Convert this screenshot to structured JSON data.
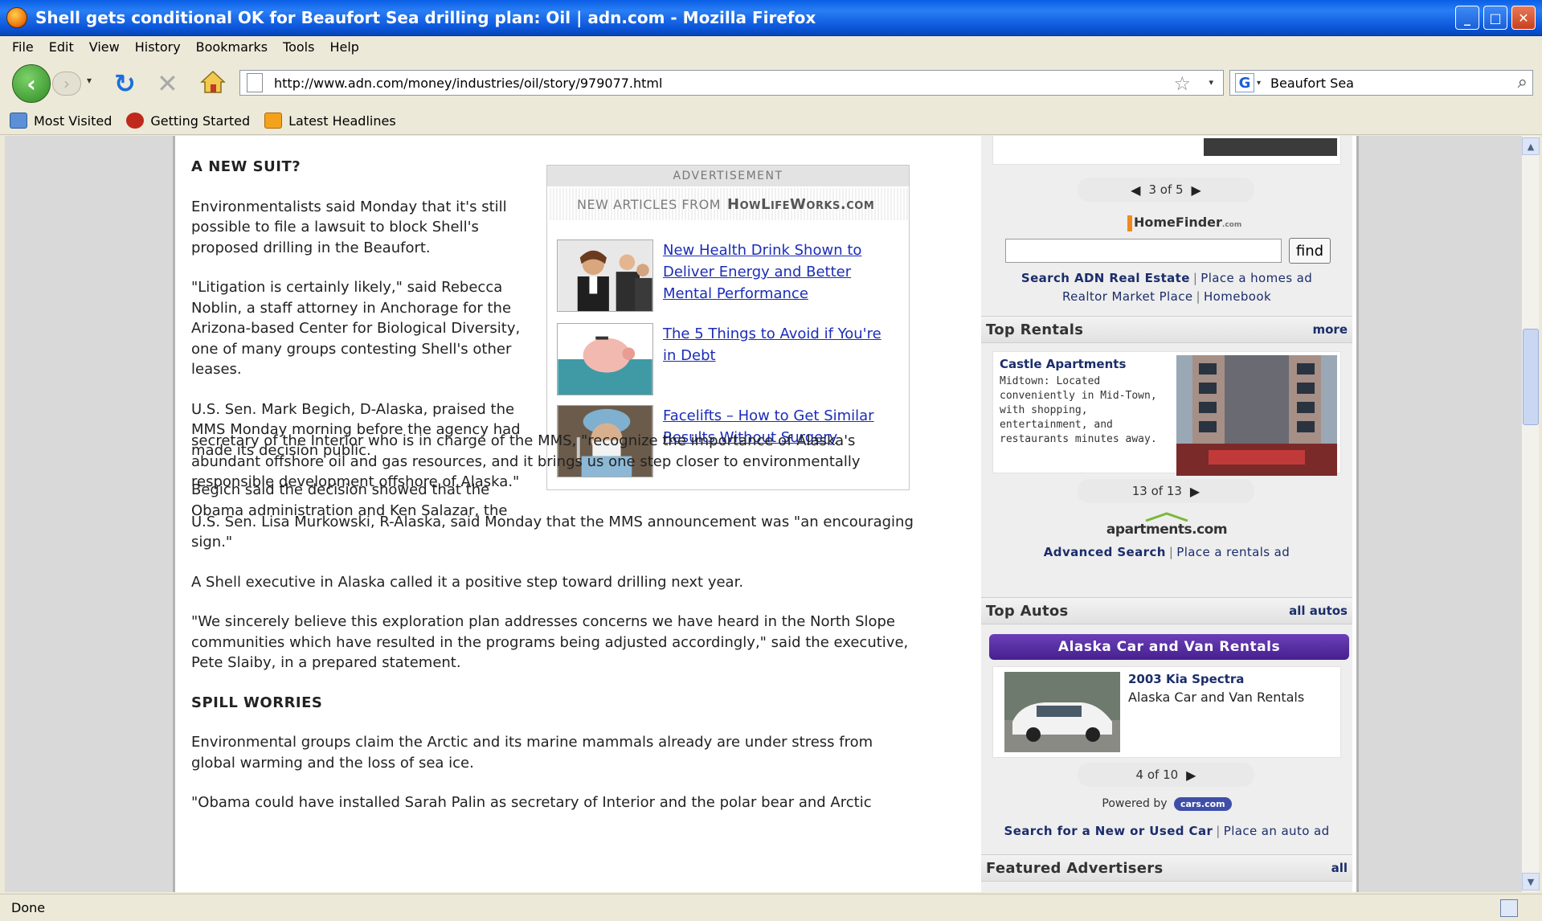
{
  "window": {
    "title": "Shell gets conditional OK for Beaufort Sea drilling plan: Oil | adn.com - Mozilla Firefox",
    "minimize": "_",
    "maximize": "□",
    "close": "✕"
  },
  "menu": [
    "File",
    "Edit",
    "View",
    "History",
    "Bookmarks",
    "Tools",
    "Help"
  ],
  "nav": {
    "back": "‹",
    "forward": "›",
    "dropdown": "▾",
    "reload": "↻",
    "stop": "✕",
    "url": "http://www.adn.com/money/industries/oil/story/979077.html",
    "star": "☆",
    "url_dropdown": "▾",
    "search_engine": "G",
    "search_engine_dropdown": "▾",
    "search_query": "Beaufort Sea",
    "search_icon": "⌕"
  },
  "bookmarks": [
    "Most Visited",
    "Getting Started",
    "Latest Headlines"
  ],
  "article": {
    "heading1": "A NEW SUIT?",
    "p1": "Environmentalists said Monday that it's still possible to file a lawsuit to block Shell's proposed drilling in the Beaufort.",
    "p2": "\"Litigation is certainly likely,\" said Rebecca Noblin, a staff attorney in Anchorage for the Arizona-based Center for Biological Diversity, one of many groups contesting Shell's other leases.",
    "p3": "U.S. Sen. Mark Begich, D-Alaska, praised the MMS Monday morning before the agency had made its decision public.",
    "p4a": "Begich said the decision showed that the Obama administration and Ken Salazar, the",
    "p4b": "secretary of the Interior who is in charge of the MMS, \"recognize the importance of Alaska's abundant offshore oil and gas resources, and it brings us one step closer to environmentally responsible development offshore of Alaska.\"",
    "p5": "U.S. Sen. Lisa Murkowski, R-Alaska, said Monday that the MMS announcement was \"an encouraging sign.\"",
    "p6": "A Shell executive in Alaska called it a positive step toward drilling next year.",
    "p7": "\"We sincerely believe this exploration plan addresses concerns we have heard in the North Slope communities which have resulted in the programs being adjusted accordingly,\" said the executive, Pete Slaiby, in a prepared statement.",
    "heading2": "SPILL WORRIES",
    "p8": "Environmental groups claim the Arctic and its marine mammals already are under stress from global warming and the loss of sea ice.",
    "p9": "\"Obama could have installed Sarah Palin as secretary of Interior and the polar bear and Arctic"
  },
  "ad": {
    "label": "ADVERTISEMENT",
    "header_prefix": "NEW ARTICLES FROM",
    "header_brand": "HowLifeWorks.com",
    "items": [
      {
        "text": "New Health Drink Shown to Deliver Energy and Better Mental Performance"
      },
      {
        "text": "The 5 Things to Avoid if You're in Debt"
      },
      {
        "text": "Facelifts – How to Get Similar Results Without Surgery"
      }
    ]
  },
  "right": {
    "homes_pager": "3 of 5",
    "homefinder_logo": "HomeFinder",
    "homefinder_logo_sub": ".com",
    "find_button": "find",
    "search_re": "Search ADN Real Estate",
    "place_homes": "Place a homes ad",
    "realtor": "Realtor Market Place",
    "homebook": "Homebook",
    "rentals_title": "Top Rentals",
    "rentals_more": "more",
    "rental_name": "Castle Apartments",
    "rental_desc": "Midtown: Located conveniently in Mid-Town, with shopping, entertainment, and restaurants minutes away.",
    "rentals_pager": "13 of 13",
    "apartments_logo": "apartments.com",
    "advanced_search": "Advanced Search",
    "place_rentals": "Place a rentals ad",
    "autos_title": "Top Autos",
    "autos_all": "all autos",
    "dealer_banner": "Alaska Car and Van Rentals",
    "car_name": "2003 Kia Spectra",
    "car_dealer": "Alaska Car and Van Rentals",
    "autos_pager": "4 of 10",
    "powered_by": "Powered by",
    "cars_logo": "cars.com",
    "search_car": "Search for a New or Used Car",
    "place_auto": "Place an auto ad",
    "featured_title": "Featured Advertisers",
    "featured_all": "all"
  },
  "status": "Done"
}
